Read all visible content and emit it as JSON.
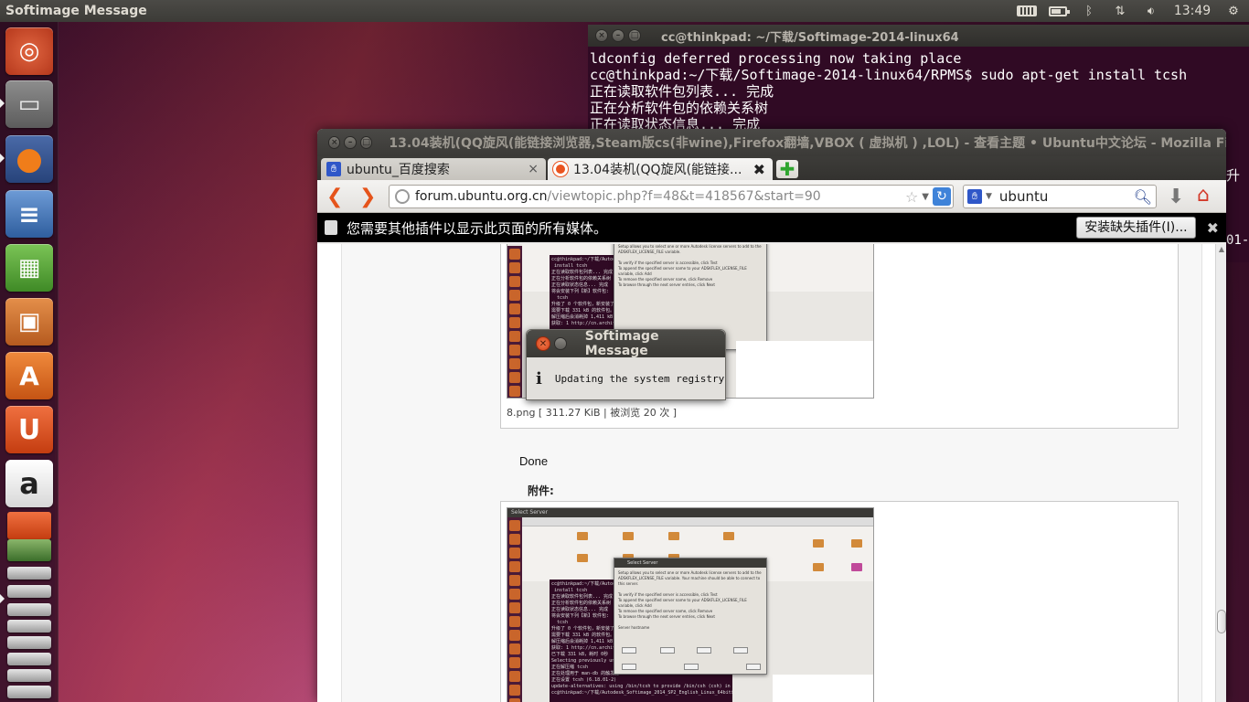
{
  "top_panel": {
    "window_title": "Softimage Message",
    "clock": "13:49",
    "icons": [
      "keyboard-icon",
      "battery-icon",
      "bluetooth-icon",
      "network-icon",
      "volume-icon",
      "gear-icon"
    ]
  },
  "launcher": {
    "items": [
      {
        "name": "dash-home",
        "label": "◎"
      },
      {
        "name": "files",
        "label": "▭"
      },
      {
        "name": "firefox",
        "label": "●"
      },
      {
        "name": "libreoffice-writer",
        "label": "≡"
      },
      {
        "name": "libreoffice-calc",
        "label": "▦"
      },
      {
        "name": "libreoffice-impress",
        "label": "▣"
      },
      {
        "name": "ubuntu-software-center",
        "label": "A"
      },
      {
        "name": "ubuntu-one",
        "label": "U"
      },
      {
        "name": "amazon",
        "label": "a"
      }
    ]
  },
  "terminal": {
    "title": "cc@thinkpad: ~/下载/Softimage-2014-linux64",
    "lines": [
      "ldconfig deferred processing now taking place",
      "cc@thinkpad:~/下载/Softimage-2014-linux64/RPMS$ sudo apt-get install tcsh",
      "正在读取软件包列表... 完成",
      "正在分析软件包的依赖关系树",
      "正在读取状态信息... 完成"
    ],
    "peek_right_1": "升",
    "peek_right_2": "01-"
  },
  "browser": {
    "title": "13.04装机(QQ旋风(能链接浏览器,Steam版cs(非wine),Firefox翻墙,VBOX ( 虚拟机 ) ,LOL) - 查看主题 • Ubuntu中文论坛 - Mozilla Firefox",
    "tabs": [
      {
        "label": "ubuntu_百度搜索",
        "close": "×"
      },
      {
        "label": "13.04装机(QQ旋风(能链接...",
        "close": "✖"
      }
    ],
    "new_tab": "✚",
    "url_domain": "forum.ubuntu.org.cn",
    "url_rest": "/viewtopic.php?f=48&t=418567&start=90",
    "search_value": "ubuntu",
    "plugin_message": "您需要其他插件以显示此页面的所有媒体。",
    "plugin_button": "安装缺失插件(I)...",
    "plugin_close": "✖"
  },
  "content": {
    "caption": "8.png [ 311.27 KiB | 被浏览 20 次 ]",
    "done_text": "Done",
    "attachments_label": "附件:",
    "thumb_1_term": "cc@thinkpad:~/下载/Autodesk\n install tcsh\n正在读取软件包列表... 完成\n正在分析软件包的依赖关系树\n正在读取状态信息... 完成\n将会安装下列【新】软件包:\n  tcsh\n升级了 0 个软件包，新安装了\n需要下载 331 kB 的软件包。\n解压缩后会消耗掉 1,411 kB\n获取: 1 http://cn.archive.u",
    "thumb_2_title": "Select Server",
    "thumb_2_dialog_title": "Select Server",
    "thumb_2_term": "cc@thinkpad:~/下载/Autodesk\n install tcsh\n正在读取软件包列表... 完成\n正在分析软件包的依赖关系树\n正在读取状态信息... 完成\n将会安装下列【新】软件包:\n  tcsh\n升级了 0 个软件包，新安装了\n需要下载 331 kB 的软件包。\n解压缩后会消耗掉 1,411 kB\n获取: 1 http://cn.archive.u\n已下载 331 kB，耗时 0秒\nSelecting previously unsele\n正在解压缩 tcsh\n正在处理用于 man-db 的触发器\n正在设置 tcsh (6.18.01-2)\nupdate-alternatives: using /bin/tcsh to provide /bin/csh (csh) in 自动模式\ncc@thinkpad:~/下载/Autodesk_Softimage_2014_SP2_English_Linux_64bit$ sudo ./setup"
  },
  "dialog": {
    "title": "Softimage Message",
    "close": "✕",
    "message": "Updating the system registry",
    "icon": "i"
  }
}
